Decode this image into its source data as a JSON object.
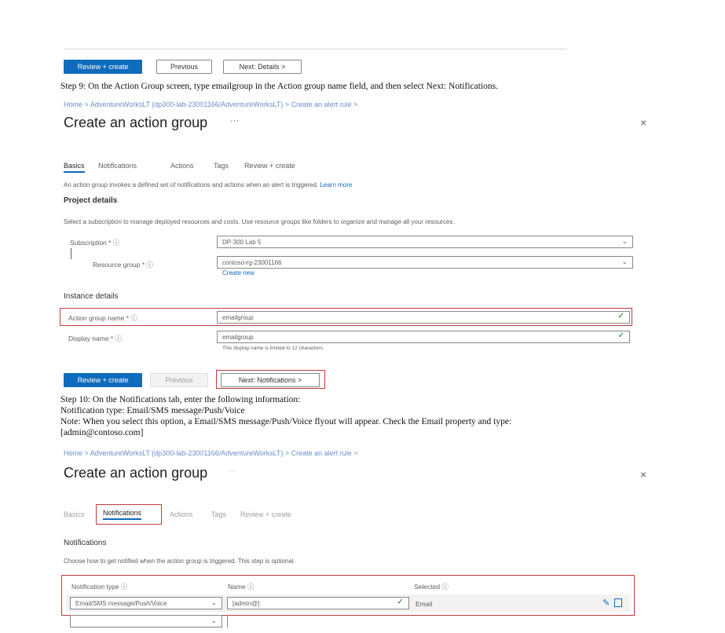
{
  "top_buttons": {
    "review_create": "Review + create",
    "previous": "Previous",
    "next": "Next: Details >"
  },
  "step9": "Step 9: On the Action Group screen, type emailgroup in the Action group name field, and then select Next: Notifications.",
  "panel1": {
    "breadcrumb": "Home > AdventureWorksLT (dp300-lab-23001166/AdventureWorksLT) > Create an alert rule >",
    "title": "Create an action group",
    "ellipsis": "···",
    "close": "×",
    "tabs": [
      "Basics",
      "Notifications",
      "Actions",
      "Tags",
      "Review + create"
    ],
    "intro": "An action group invokes a defined set of notifications and actions when an alert is triggered.",
    "learn_more": "Learn more",
    "project_details": "Project details",
    "project_desc": "Select a subscription to manage deployed resources and costs. Use resource groups like folders to organize and manage all your resources.",
    "subscription_label": "Subscription * ⓘ",
    "subscription_value": "DP-300 Lab 5",
    "resource_group_label": "Resource group * ⓘ",
    "resource_group_value": "contoso-rg-23001166",
    "create_new": "Create new",
    "instance_details": "Instance details",
    "action_group_name_label": "Action group name * ⓘ",
    "action_group_name_value": "emailgroup",
    "display_name_label": "Display name * ⓘ",
    "display_name_value": "emailgroup",
    "display_name_hint": "This display name is limited to 12 characters.",
    "buttons": {
      "review_create": "Review + create",
      "previous": "Previous",
      "next": "Next: Notifications >"
    }
  },
  "step10": {
    "line1": "Step 10: On the Notifications tab, enter the following information:",
    "line2": "Notification type: Email/SMS message/Push/Voice",
    "line3": "Note: When you select this option, a Email/SMS message/Push/Voice flyout will appear. Check the Email property and type:",
    "line4": "[admin@contoso.com]"
  },
  "panel2": {
    "breadcrumb": "Home > AdventureWorksLT (dp300-lab-23001166/AdventureWorksLT) > Create an alert rule >",
    "title": "Create an action group",
    "ellipsis": "···",
    "close": "×",
    "tabs": [
      "Basics",
      "Notifications",
      "Actions",
      "Tags",
      "Review + create"
    ],
    "section": "Notifications",
    "desc": "Choose how to get notified when the action group is triggered. This step is optional.",
    "col_type": "Notification type ⓘ",
    "col_name": "Name ⓘ",
    "col_selected": "Selected ⓘ",
    "row_type": "Email/SMS message/Push/Voice",
    "row_name": "[admin@]",
    "row_selected": "Email"
  },
  "colors": {
    "accent": "#0f6cbd",
    "highlight": "#c43a3a"
  }
}
